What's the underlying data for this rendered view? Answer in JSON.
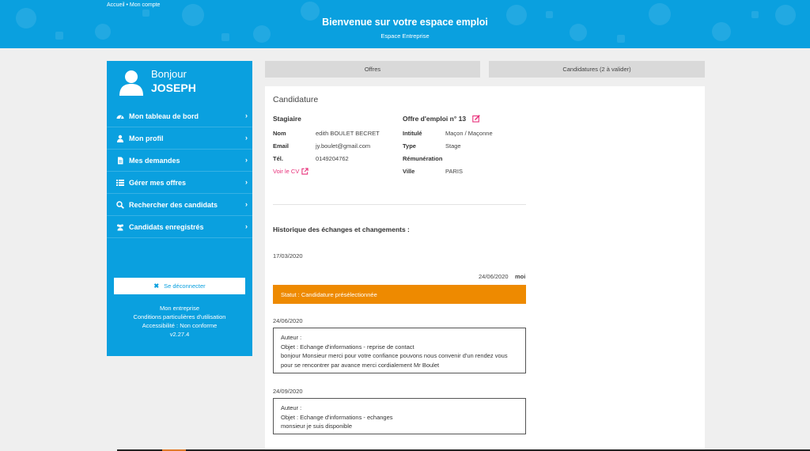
{
  "header": {
    "breadcrumb": "Accueil • Mon compte",
    "title": "Bienvenue sur votre espace emploi",
    "subtitle": "Espace Entreprise"
  },
  "sidebar": {
    "greeting": "Bonjour",
    "name": "JOSEPH",
    "items": [
      {
        "label": "Mon tableau de bord",
        "icon": "dashboard-icon"
      },
      {
        "label": "Mon profil",
        "icon": "user-icon"
      },
      {
        "label": "Mes demandes",
        "icon": "file-icon"
      },
      {
        "label": "Gérer mes offres",
        "icon": "list-icon"
      },
      {
        "label": "Rechercher des candidats",
        "icon": "search-icon"
      },
      {
        "label": "Candidats enregistrés",
        "icon": "users-icon"
      }
    ],
    "logout_label": "Se déconnecter",
    "links": {
      "company": "Mon entreprise",
      "terms": "Conditions particulières d'utilisation",
      "accessibility": "Accessibilité : Non conforme",
      "version": "v2.27.4"
    }
  },
  "tabs": {
    "offres": "Offres",
    "candidatures": "Candidatures (2 à valider)"
  },
  "candidature": {
    "title": "Candidature",
    "stagiaire": {
      "heading": "Stagiaire",
      "nom_label": "Nom",
      "nom": "edith BOULET BECRET",
      "email_label": "Email",
      "email": "jy.boulet@gmail.com",
      "tel_label": "Tél.",
      "tel": "0149204762",
      "cv_link": "Voir le CV"
    },
    "offre": {
      "heading": "Offre d'emploi n° 13",
      "intitule_label": "Intitulé",
      "intitule": "Maçon / Maçonne",
      "type_label": "Type",
      "type": "Stage",
      "remuneration_label": "Rémunération",
      "ville_label": "Ville",
      "ville": "PARIS"
    }
  },
  "history": {
    "title": "Historique des échanges et changements :",
    "date1": "17/03/2020",
    "date2": "24/06/2020",
    "me": "moi",
    "status": "Statut : Candidature présélectionnée",
    "msg1_date": "24/06/2020",
    "msg1": {
      "auteur": "Auteur :",
      "objet": "Objet : Echange d'informations - reprise de contact",
      "body": "bonjour Monsieur merci pour votre confiance pouvons nous convenir d'un rendez vous pour se rencontrer par avance merci cordialement Mr Boulet"
    },
    "msg2_date": "24/09/2020",
    "msg2": {
      "auteur": "Auteur :",
      "objet": "Objet : Echange d'informations - echanges",
      "body": "monsieur je suis disponible"
    }
  },
  "colors": {
    "brand": "#0aa0df",
    "status": "#ee8a00",
    "link": "#e8307a"
  }
}
